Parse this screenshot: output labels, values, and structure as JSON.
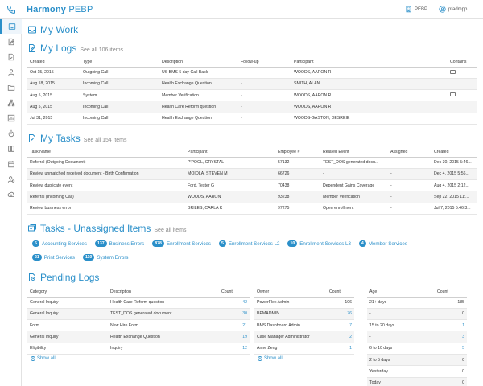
{
  "app": {
    "brand_main": "Harmony",
    "brand_sub": "PEBP"
  },
  "topbar": {
    "org_label": "PEBP",
    "user_label": "pfadmpp"
  },
  "my_work": {
    "title": "My Work"
  },
  "my_logs": {
    "title": "My Logs",
    "see_all": "See all 106 items",
    "columns": [
      "Created",
      "Type",
      "Description",
      "Follow-up",
      "Participant",
      "Contains"
    ],
    "rows": [
      {
        "created": "Oct 15, 2015",
        "type": "Outgoing Call",
        "description": "US BMS 5 day Call Back",
        "followup": "-",
        "participant": "WOODS, AARON R",
        "contains": true
      },
      {
        "created": "Aug 18, 2015",
        "type": "Incoming Call",
        "description": "Health Exchange Question",
        "followup": "-",
        "participant": "SMITH, ALAN",
        "contains": false
      },
      {
        "created": "Aug 5, 2015",
        "type": "System",
        "description": "Member Verification",
        "followup": "-",
        "participant": "WOODS, AARON R",
        "contains": true
      },
      {
        "created": "Aug 5, 2015",
        "type": "Incoming Call",
        "description": "Health Care Reform question",
        "followup": "-",
        "participant": "WOODS, AARON R",
        "contains": false
      },
      {
        "created": "Jul 31, 2015",
        "type": "Incoming Call",
        "description": "Health Exchange Question",
        "followup": "-",
        "participant": "WOODS-GASTON, DESREIE",
        "contains": false
      }
    ]
  },
  "my_tasks": {
    "title": "My Tasks",
    "see_all": "See all 154 items",
    "columns": [
      "Task Name",
      "Participant",
      "Employee #",
      "Related Event",
      "Assigned",
      "Created"
    ],
    "rows": [
      {
        "name": "Referral (Outgoing Document)",
        "participant": "P'POOL, CRYSTAL",
        "employee": "57132",
        "event": "TEST_DOS generated docu...",
        "assigned": "-",
        "created": "Dec 30, 2015 5:46..."
      },
      {
        "name": "Review unmatched received document - Birth Confirmation",
        "participant": "MOIOLA, STEVEN M",
        "employee": "66726",
        "event": "-",
        "assigned": "-",
        "created": "Dec 4, 2015 5:56..."
      },
      {
        "name": "Review duplicate event",
        "participant": "Ford, Tester G",
        "employee": "70438",
        "event": "Dependent Gains Coverage",
        "assigned": "-",
        "created": "Aug 4, 2015 2:12..."
      },
      {
        "name": "Referral (Incoming Call)",
        "participant": "WOODS, AARON",
        "employee": "93238",
        "event": "Member Verification",
        "assigned": "-",
        "created": "Sep 22, 2015 11:..."
      },
      {
        "name": "Review business error",
        "participant": "BRILES, CARLA K",
        "employee": "97275",
        "event": "Open enrollment",
        "assigned": "-",
        "created": "Jul 7, 2015 5:46:3..."
      }
    ]
  },
  "unassigned": {
    "title": "Tasks - Unassigned Items",
    "see_all": "See all items",
    "row1": [
      {
        "count": "5",
        "label": "Accounting Services"
      },
      {
        "count": "137",
        "label": "Business Errors"
      },
      {
        "count": "878",
        "label": "Enrollment Services"
      },
      {
        "count": "5",
        "label": "Enrollment Services L2"
      },
      {
        "count": "10",
        "label": "Enrollment Services L3"
      },
      {
        "count": "4",
        "label": "Member Services"
      }
    ],
    "row2": [
      {
        "count": "21",
        "label": "Print Services"
      },
      {
        "count": "110",
        "label": "System Errors"
      }
    ]
  },
  "pending_logs": {
    "title": "Pending Logs",
    "show_all": "Show all",
    "category_table": {
      "columns": [
        "Category",
        "Description",
        "Count"
      ],
      "rows": [
        {
          "category": "General Inquiry",
          "description": "Health Care Reform question",
          "count": "42"
        },
        {
          "category": "General Inquiry",
          "description": "TEST_DOS generated document",
          "count": "30"
        },
        {
          "category": "Form",
          "description": "New Hire Form",
          "count": "21"
        },
        {
          "category": "General Inquiry",
          "description": "Health Exchange Question",
          "count": "19"
        },
        {
          "category": "Eligibility",
          "description": "Inquiry",
          "count": "12"
        }
      ]
    },
    "owner_table": {
      "columns": [
        "Owner",
        "Count"
      ],
      "rows": [
        {
          "owner": "PowerFlex Admin",
          "count": "106",
          "link": false
        },
        {
          "owner": "BPMADMIN",
          "count": "76",
          "link": true
        },
        {
          "owner": "BMS Dashboard Admin",
          "count": "7",
          "link": true
        },
        {
          "owner": "Case Manager Administrator",
          "count": "2",
          "link": true
        },
        {
          "owner": "Anne Zeng",
          "count": "1",
          "link": true
        }
      ]
    },
    "age_table": {
      "columns": [
        "Age",
        "Count"
      ],
      "rows": [
        {
          "age": "21+ days",
          "count": "185",
          "link": false
        },
        {
          "age": "-",
          "count": "0",
          "link": false
        },
        {
          "age": "15 to 20 days",
          "count": "1",
          "link": true
        },
        {
          "age": "-",
          "count": "3",
          "link": true
        },
        {
          "age": "6 to 10 days",
          "count": "5",
          "link": true
        },
        {
          "age": "2 to 5 days",
          "count": "0",
          "link": false
        },
        {
          "age": "Yesterday",
          "count": "0",
          "link": false
        },
        {
          "age": "Today",
          "count": "0",
          "link": false
        }
      ]
    }
  },
  "colors": {
    "accent": "#2a8fc9",
    "border": "#e2e2e2",
    "shade": "#f4f4f4"
  }
}
